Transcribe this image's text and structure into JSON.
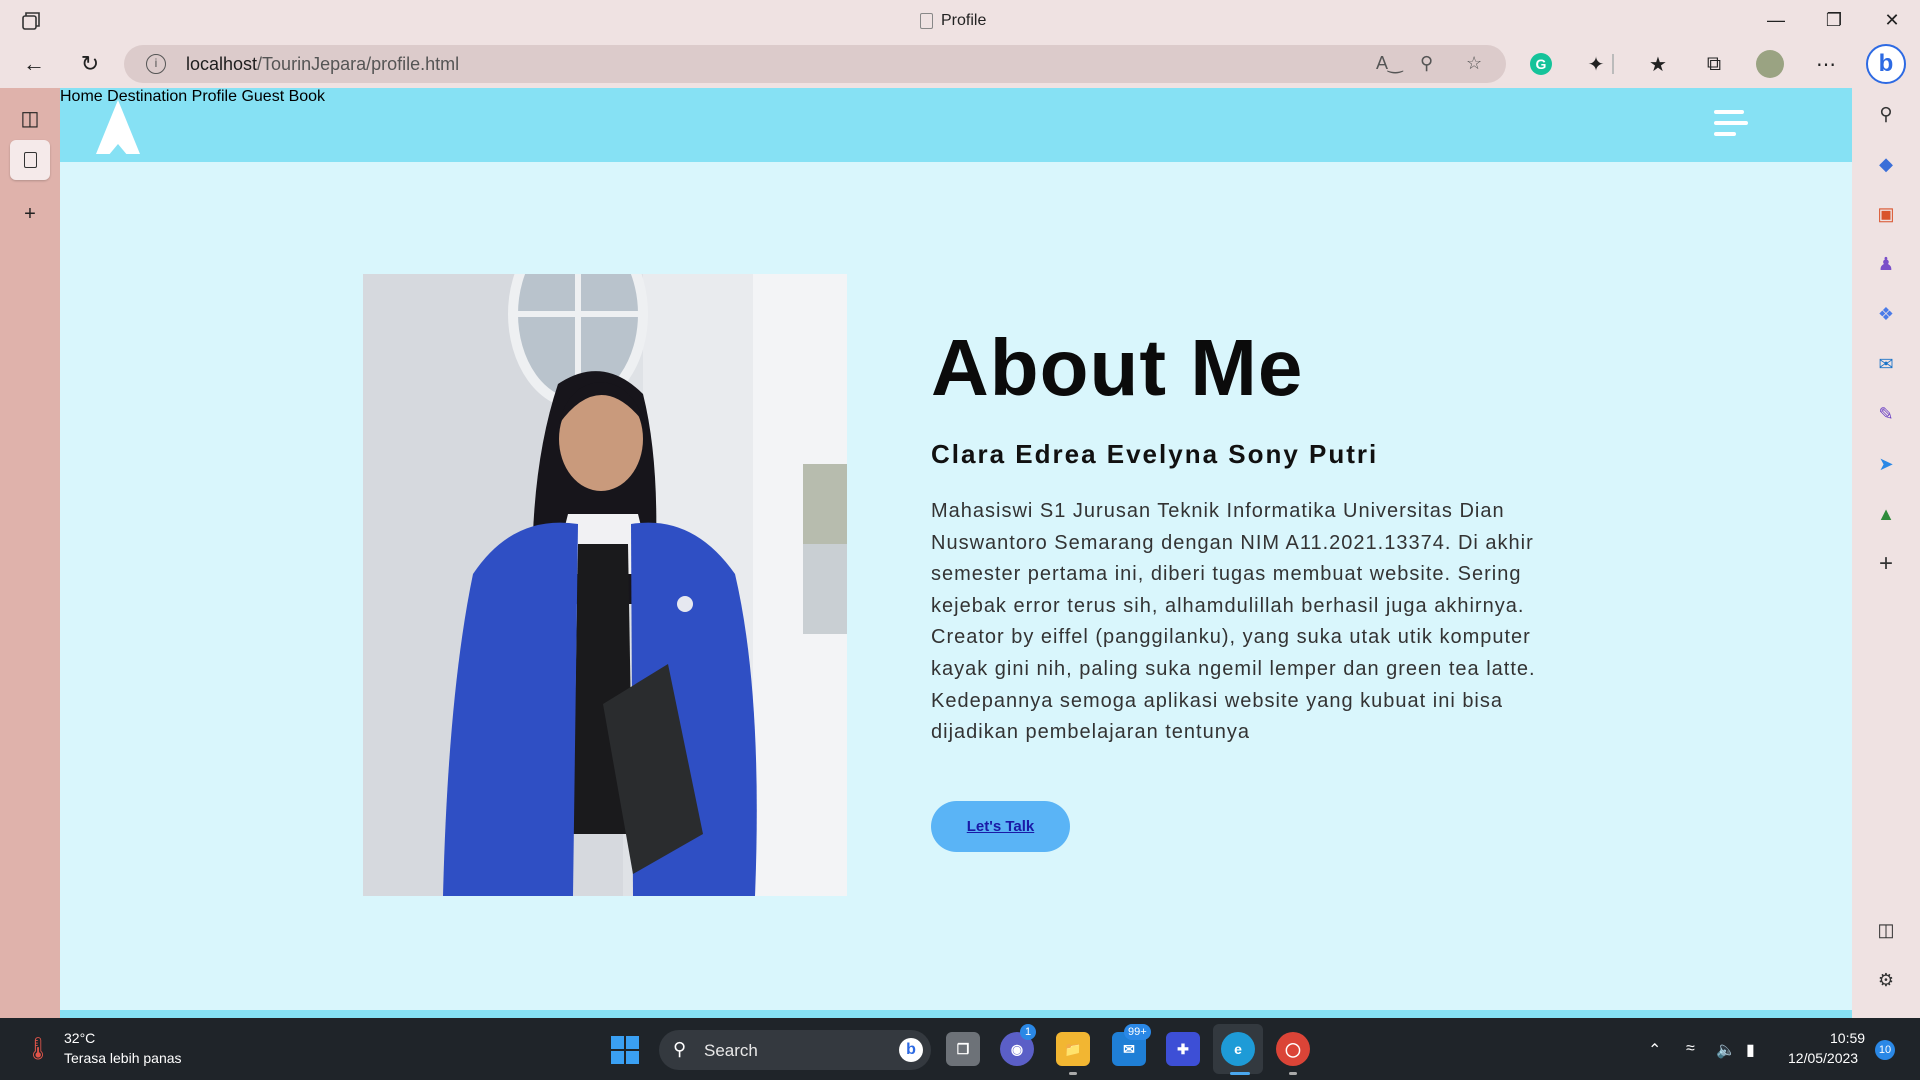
{
  "browser": {
    "tab_title": "Profile",
    "url_host": "localhost",
    "url_path": "/TourinJepara/profile.html"
  },
  "site": {
    "nav": {
      "items": [
        {
          "label": "Home"
        },
        {
          "label": "Destination"
        },
        {
          "label": "Profile"
        },
        {
          "label": "Guest Book"
        }
      ]
    },
    "about": {
      "title": "About Me",
      "name": "Clara Edrea Evelyna Sony Putri",
      "description": "Mahasiswi S1 Jurusan Teknik Informatika Universitas Dian Nuswantoro Semarang dengan NIM A11.2021.13374. Di akhir semester pertama ini, diberi tugas membuat website. Sering kejebak error terus sih, alhamdulillah berhasil juga akhirnya. Creator by eiffel (panggilanku), yang suka utak utik komputer kayak gini nih, paling suka ngemil lemper dan green tea latte. Kedepannya semoga aplikasi website yang kubuat ini bisa dijadikan pembelajaran tentunya",
      "button_label": "Let's Talk"
    }
  },
  "taskbar": {
    "weather_temp": "32°C",
    "weather_desc": "Terasa lebih panas",
    "search_label": "Search",
    "teams_badge": "1",
    "mail_badge": "99+",
    "time": "10:59",
    "date": "12/05/2023",
    "notification_count": "10"
  },
  "colors": {
    "nav_bg": "#86e1f4",
    "page_bg": "#d9f6fc",
    "button_bg": "#5ab4f6",
    "sidebar_bg": "#dfb2ab"
  }
}
